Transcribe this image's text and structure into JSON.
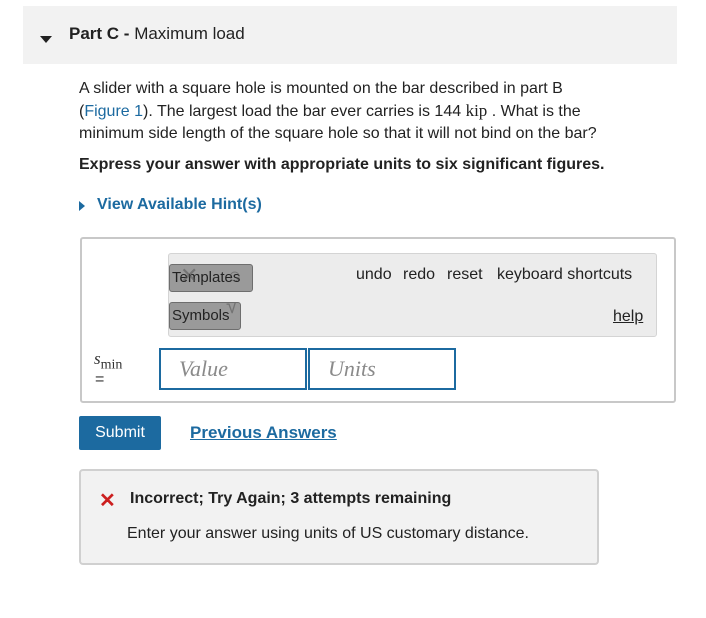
{
  "part": {
    "label": "Part C",
    "separator": " - ",
    "title": "Maximum load"
  },
  "problem": {
    "text_1": "A slider with a square hole is mounted on the bar described in part B",
    "paren_open": "(",
    "figure_link": "Figure 1",
    "text_2": "). The largest load the bar ever carries is 144 ",
    "load_unit": "kip",
    "text_3": " . What is the",
    "text_4": "minimum side length of the square hole so that it will not bind on the bar?"
  },
  "instructions": "Express your answer with appropriate units to six significant figures.",
  "hint_link": "View Available Hint(s)",
  "toolbar": {
    "templates": "Templates",
    "symbols": "Symbols",
    "undo": "undo",
    "redo": "redo",
    "reset": "reset",
    "shortcuts": "keyboard shortcuts",
    "help": "help"
  },
  "answer": {
    "variable": "s",
    "subscript": "min",
    "equals": "=",
    "value_placeholder": "Value",
    "units_placeholder": "Units"
  },
  "submit_label": "Submit",
  "previous_answers": "Previous Answers",
  "feedback": {
    "status": "Incorrect; Try Again; 3 attempts remaining",
    "message": "Enter your answer using units of US customary distance.",
    "status_color": "#cc1f1f"
  },
  "colors": {
    "accent": "#1c6aa0"
  }
}
